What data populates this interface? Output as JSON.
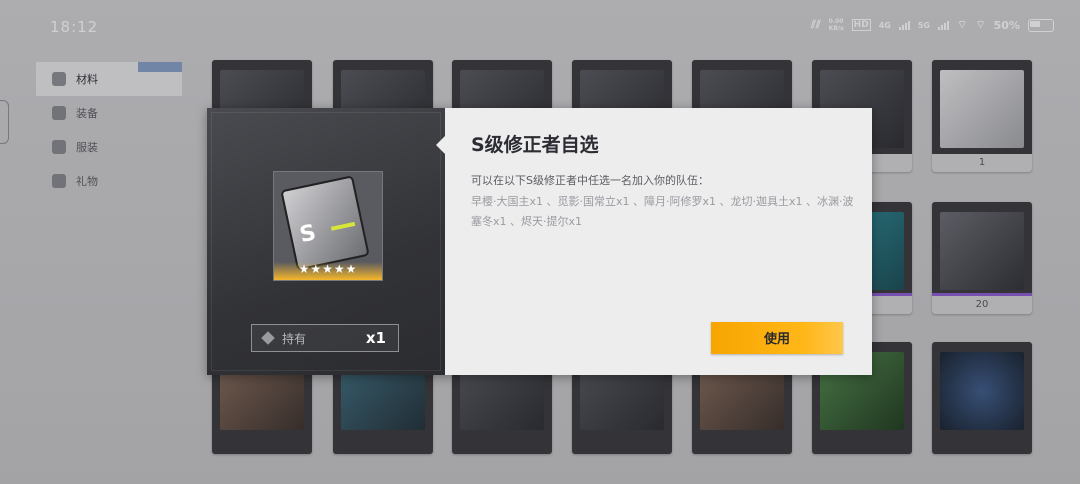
{
  "status_bar": {
    "time": "18:12",
    "network_speed": "0.00\nKB/s",
    "hd_badge": "HD",
    "net1": "4G",
    "net2": "5G",
    "battery": "50%"
  },
  "sidebar": {
    "items": [
      {
        "label": "材料",
        "icon": "box-icon",
        "active": true
      },
      {
        "label": "装备",
        "icon": "armor-icon",
        "active": false
      },
      {
        "label": "服装",
        "icon": "outfit-icon",
        "active": false
      },
      {
        "label": "礼物",
        "icon": "gift-icon",
        "active": false
      }
    ]
  },
  "background_cards": [
    {
      "footer": ""
    },
    {
      "footer": ""
    },
    {
      "footer": ""
    },
    {
      "footer": ""
    },
    {
      "footer": ""
    },
    {
      "footer": ""
    },
    {
      "footer": "1"
    },
    {
      "footer": "20"
    }
  ],
  "modal": {
    "title": "S级修正者自选",
    "description_intro": "可以在以下S级修正者中任选一名加入你的队伍：",
    "description_options": "早樱·大国主x1 、觅影·国常立x1 、障月·阿修罗x1 、龙切·迦具土x1 、冰渊·波塞冬x1 、烬天·提尔x1",
    "item_letter": "S",
    "stars": "★★★★★",
    "owned_label": "持有",
    "owned_count": "x1",
    "use_button": "使用"
  },
  "colors": {
    "accent": "#f7a500",
    "modal_bg": "#ededee",
    "modal_left_bg": "#323337"
  }
}
